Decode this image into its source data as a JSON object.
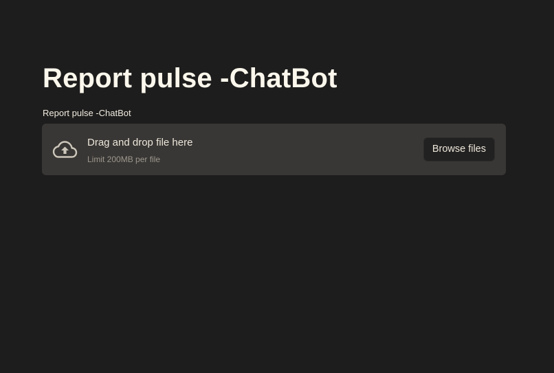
{
  "page": {
    "title": "Report pulse -ChatBot"
  },
  "uploader": {
    "label": "Report pulse -ChatBot",
    "drop_text": "Drag and drop file here",
    "limit_text": "Limit 200MB per file",
    "browse_label": "Browse files",
    "icon": "cloud-upload-icon"
  },
  "colors": {
    "background": "#1e1d1d",
    "dropzone": "#393735",
    "title_text": "#fbf7ec",
    "button_bg": "#222121"
  }
}
